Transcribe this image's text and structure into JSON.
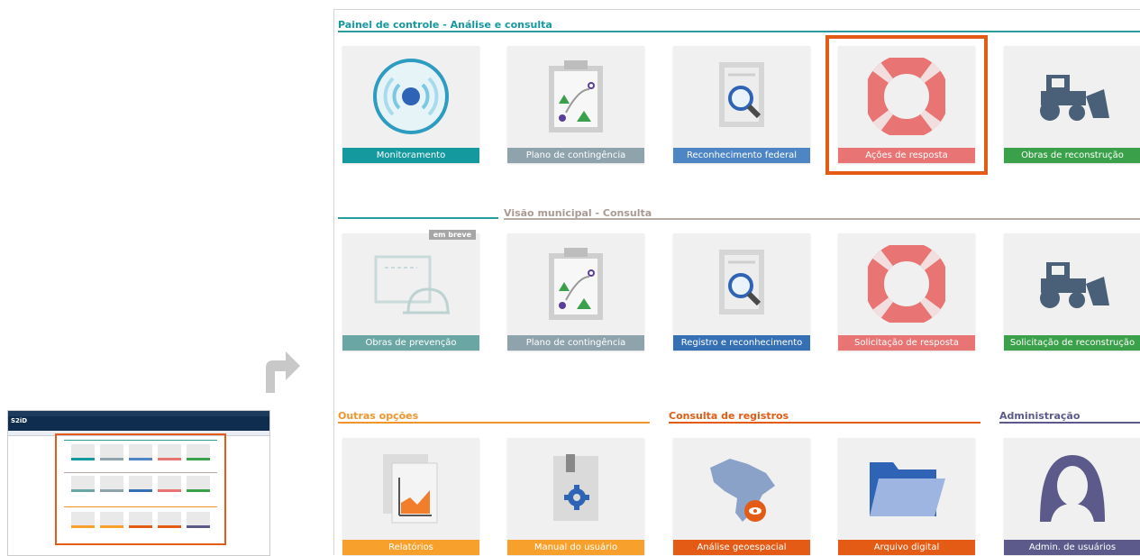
{
  "thumbnail": {
    "logo": "S2iD"
  },
  "panel": {
    "section1": {
      "title": "Painel de controle - Análise e consulta",
      "color": "#2a9a9a"
    },
    "section2": {
      "title": "Visão municipal - Consulta",
      "color": "#b7aba3"
    },
    "section3": {
      "title": "Outras opções",
      "color": "#f0942b"
    },
    "section4": {
      "title": "Consulta de registros",
      "color": "#e35b14"
    },
    "section5": {
      "title": "Administração",
      "color": "#5b5a8a"
    },
    "row1": [
      {
        "label": "Monitoramento",
        "color": "#14999e",
        "icon": "broadcast-icon"
      },
      {
        "label": "Plano de contingência",
        "color": "#8fa3ad",
        "icon": "clipboard-map-icon"
      },
      {
        "label": "Reconhecimento federal",
        "color": "#4e85c4",
        "icon": "document-search-icon"
      },
      {
        "label": "Ações de resposta",
        "color": "#e87474",
        "icon": "lifebuoy-icon"
      },
      {
        "label": "Obras de reconstrução",
        "color": "#3aa14a",
        "icon": "bulldozer-icon"
      }
    ],
    "row2": [
      {
        "label": "Obras de prevenção",
        "color": "#6aa6a4",
        "icon": "helmet-blueprint-icon",
        "badge": "em breve"
      },
      {
        "label": "Plano de contingência",
        "color": "#8fa3ad",
        "icon": "clipboard-map-icon"
      },
      {
        "label": "Registro e reconhecimento",
        "color": "#3570b4",
        "icon": "document-search-icon"
      },
      {
        "label": "Solicitação de resposta",
        "color": "#e87474",
        "icon": "lifebuoy-icon"
      },
      {
        "label": "Solicitação de reconstrução",
        "color": "#3aa14a",
        "icon": "bulldozer-icon"
      }
    ],
    "row3": [
      {
        "label": "Relatórios",
        "color": "#f7a12c",
        "icon": "chart-report-icon"
      },
      {
        "label": "Manual do usuário",
        "color": "#f7a12c",
        "icon": "manual-gear-icon"
      },
      {
        "label": "Análise geoespacial",
        "color": "#e35b14",
        "icon": "brazil-map-icon"
      },
      {
        "label": "Arquivo digital",
        "color": "#e35b14",
        "icon": "folder-icon"
      },
      {
        "label": "Admin. de usuários",
        "color": "#5b5a8a",
        "icon": "user-avatar-icon"
      }
    ]
  }
}
